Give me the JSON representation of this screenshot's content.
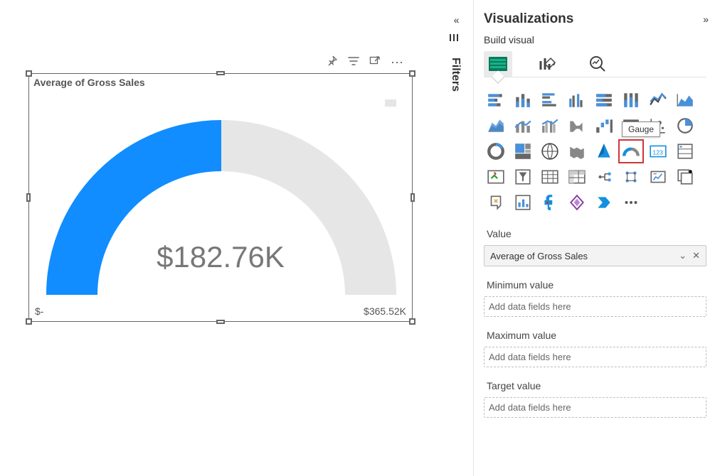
{
  "chart_data": {
    "type": "gauge",
    "title": "Average of Gross Sales",
    "value": 182760,
    "value_label": "$182.76K",
    "min": 0,
    "min_label": "$-",
    "max": 365520,
    "max_label": "$365.52K",
    "fill_color": "#118dff",
    "track_color": "#e6e6e6"
  },
  "canvas": {
    "toolbar": {
      "pin": "📌",
      "filter": "filter",
      "focus": "focus",
      "more": "⋯"
    }
  },
  "filters_tab": {
    "label": "Filters"
  },
  "viz_pane": {
    "title": "Visualizations",
    "subtitle": "Build visual",
    "tooltip": "Gauge",
    "wells": {
      "value": {
        "label": "Value",
        "field": "Average of Gross Sales"
      },
      "min": {
        "label": "Minimum value",
        "placeholder": "Add data fields here"
      },
      "max": {
        "label": "Maximum value",
        "placeholder": "Add data fields here"
      },
      "target": {
        "label": "Target value",
        "placeholder": "Add data fields here"
      }
    }
  }
}
